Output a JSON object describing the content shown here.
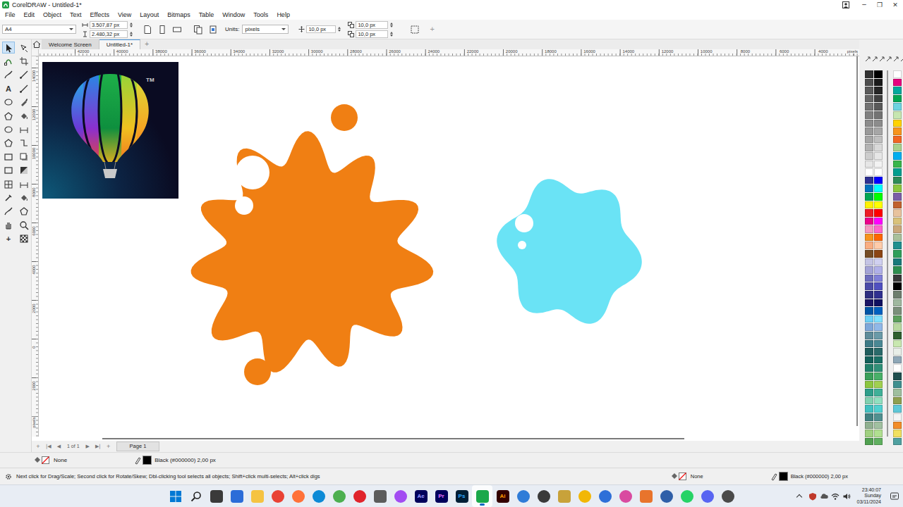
{
  "window": {
    "title": "CorelDRAW - Untitled-1*",
    "controls": [
      "─",
      "❐",
      "✕"
    ]
  },
  "menu": [
    "File",
    "Edit",
    "Object",
    "Text",
    "Effects",
    "View",
    "Layout",
    "Bitmaps",
    "Table",
    "Window",
    "Tools",
    "Help"
  ],
  "property_bar": {
    "page_size": "A4",
    "width": "3.507,87 px",
    "height": "2.480,32 px",
    "units_label": "Units:",
    "units": "pixels",
    "nudge": "10,0 px",
    "dup_x": "10,0 px",
    "dup_y": "10,0 px",
    "add": "+"
  },
  "tools": [
    {
      "selected": true
    },
    {
      "selected": false
    },
    {
      "selected": false
    },
    {
      "selected": false
    },
    {
      "selected": false
    },
    {
      "selected": false
    },
    {
      "selected": false,
      "glyph": "A"
    },
    {
      "selected": false
    },
    {
      "selected": false
    },
    {
      "selected": false
    },
    {
      "selected": false
    },
    {
      "selected": false
    },
    {
      "selected": false
    },
    {
      "selected": false
    },
    {
      "selected": false
    },
    {
      "selected": false
    },
    {
      "selected": false
    },
    {
      "selected": false
    },
    {
      "selected": false
    },
    {
      "selected": false
    },
    {
      "selected": false
    },
    {
      "selected": false
    },
    {
      "selected": false
    },
    {
      "selected": false
    },
    {
      "selected": false
    },
    {
      "selected": false
    },
    {
      "selected": false
    },
    {
      "selected": false
    },
    {
      "selected": false,
      "glyph": "+"
    },
    {
      "selected": false
    }
  ],
  "doc_tabs": [
    {
      "label": "Welcome Screen",
      "selected": false
    },
    {
      "label": "Untitled-1*",
      "selected": true
    }
  ],
  "doc_tab_add": "+",
  "ruler": {
    "h_labels": [
      "42000",
      "40000",
      "38000",
      "36000",
      "34000",
      "32000",
      "30000",
      "28000",
      "26000",
      "24000",
      "22000",
      "20000",
      "18000",
      "16000",
      "14000",
      "12000",
      "10000",
      "8000",
      "6000",
      "4000"
    ],
    "v_labels": [
      "14000",
      "12000",
      "10000",
      "8000",
      "6000",
      "4000",
      "2000",
      "0",
      "2000"
    ],
    "unit": "pixels"
  },
  "canvas": {
    "logo": {
      "tm": "TM"
    },
    "shapes": [
      {
        "kind": "splat",
        "color": "#f07f13"
      },
      {
        "kind": "blob",
        "color": "#6ae3f5"
      }
    ]
  },
  "page_nav": {
    "before": [
      "+",
      "|◀",
      "◀"
    ],
    "counter": "1 of 1",
    "after": [
      "▶",
      "▶|",
      "+"
    ],
    "pages": [
      {
        "label": "Page 1",
        "selected": true
      }
    ]
  },
  "palettes": [
    {
      "columns": [
        [
          "#333333",
          "#4d4d4d",
          "#595959",
          "#666666",
          "#737373",
          "#808080",
          "#8c8c8c",
          "#999999",
          "#a6a6a6",
          "#b3b3b3",
          "#cccccc",
          "#e6e6e6",
          "#ffffff",
          "#2e3192",
          "#0072bc",
          "#00a651",
          "#fff200",
          "#ed1c24",
          "#ec008c",
          "#f49ac1",
          "#f7941d",
          "#f9ad81",
          "#754c24",
          "#c4c4e4",
          "#a3a3d6",
          "#6d6dbd",
          "#4b4ba8",
          "#2e2e80",
          "#1b1464",
          "#0054a6",
          "#6dcff6",
          "#7da7d9",
          "#5e8c9a",
          "#3d7a86",
          "#1f5c5c",
          "#13605a",
          "#20806a",
          "#3aa05a",
          "#8cc63f",
          "#2e9e8a",
          "#80d0b0",
          "#40c0c0",
          "#408080",
          "#90b090",
          "#a0d080",
          "#50a050"
        ],
        [
          "#000000",
          "#1a1a1a",
          "#262626",
          "#404040",
          "#595959",
          "#737373",
          "#8c8c8c",
          "#a6a6a6",
          "#bfbfbf",
          "#d9d9d9",
          "#e6e6e6",
          "#f2f2f2",
          "#ffffff",
          "#0000ff",
          "#00ffff",
          "#00ff00",
          "#ffff00",
          "#ff0000",
          "#ff00ff",
          "#ff66cc",
          "#ff6600",
          "#ffccaa",
          "#8b4513",
          "#d0d0f0",
          "#b0b0e8",
          "#8080d8",
          "#5050c0",
          "#303090",
          "#101060",
          "#0060c0",
          "#80e0ff",
          "#90b8e8",
          "#6a9aa8",
          "#4a8894",
          "#2a6a6a",
          "#1a7066",
          "#309078",
          "#48b068",
          "#a0d050",
          "#40b098",
          "#90e0c0",
          "#50d0d0",
          "#509090",
          "#a0c0a0",
          "#b0e090",
          "#60b060"
        ]
      ]
    },
    {
      "columns": [
        [
          "#ffffff",
          "#e6007e",
          "#00a99d",
          "#00a651",
          "#6dd3e0",
          "#c6e6b0",
          "#ffd200",
          "#f7941d",
          "#f26522",
          "#a8d08d",
          "#00aeef",
          "#39b54a",
          "#009e8e",
          "#2e8b57",
          "#8dc63f",
          "#7b5ea7",
          "#c1622f",
          "#e8c39e",
          "#d9c27a",
          "#c9a77a",
          "#a8c09a",
          "#1f8f8f",
          "#2f9e5a",
          "#1a7a7a",
          "#2f8f4f",
          "#3a3a3a",
          "#000000",
          "#6e7e6e",
          "#9fb89f",
          "#7a8f7a",
          "#5c9e5c",
          "#b8d8a0",
          "#2f5f2f",
          "#c8e8b0",
          "#e8eee8",
          "#8fa8b8",
          "#ffffff",
          "#1f4f4f",
          "#3f8f8f",
          "#9fbf9f",
          "#8f9f4f",
          "#5fc8d8",
          "#f4f4f4",
          "#f28c28",
          "#f0e060",
          "#4fa0a0"
        ]
      ]
    }
  ],
  "fill_outline": {
    "fill": "None",
    "outline": "Black (#000000) 2,00 px",
    "outline_color": "#000000"
  },
  "status_bar": {
    "hint": "Next click for Drag/Scale; Second click for Rotate/Skew; Dbl-clicking tool selects all objects; Shift+click multi-selects; Alt+click digs",
    "fill": "None",
    "outline": "Black (#000000) 2,00 px",
    "outline_color": "#000000"
  },
  "taskbar": {
    "apps": [
      {
        "kind": "win",
        "color": "#0078d4",
        "running": false
      },
      {
        "kind": "search",
        "color": "#222222",
        "running": false
      },
      {
        "kind": "tile",
        "color": "#3a3a3a",
        "running": false
      },
      {
        "kind": "tile",
        "color": "#2b6cd8",
        "running": false
      },
      {
        "kind": "tile",
        "color": "#f5c342",
        "running": false
      },
      {
        "kind": "round",
        "color": "#e94235",
        "running": false
      },
      {
        "kind": "round",
        "color": "#ff7139",
        "running": false
      },
      {
        "kind": "round",
        "color": "#0c8ad6",
        "running": false
      },
      {
        "kind": "round",
        "color": "#4caf50",
        "running": false
      },
      {
        "kind": "round",
        "color": "#e0242c",
        "running": false
      },
      {
        "kind": "tile",
        "color": "#5c5c5c",
        "running": false
      },
      {
        "kind": "round",
        "color": "#a24cf2",
        "running": false
      },
      {
        "kind": "tile",
        "color": "#00005b",
        "label": "Ae",
        "label_color": "#9999ff",
        "running": false
      },
      {
        "kind": "tile",
        "color": "#00005b",
        "label": "Pr",
        "label_color": "#ea77ff",
        "running": false
      },
      {
        "kind": "tile",
        "color": "#001e36",
        "label": "Ps",
        "label_color": "#31a8ff",
        "running": false
      },
      {
        "kind": "tile",
        "color": "#1aa84a",
        "running": true
      },
      {
        "kind": "tile",
        "color": "#330000",
        "label": "Ai",
        "label_color": "#ff9a00",
        "running": false
      },
      {
        "kind": "round",
        "color": "#2f7cd8",
        "running": false
      },
      {
        "kind": "round",
        "color": "#3a3a3a",
        "running": false
      },
      {
        "kind": "tile",
        "color": "#c8a23a",
        "running": false
      },
      {
        "kind": "round",
        "color": "#f2b705",
        "running": false
      },
      {
        "kind": "round",
        "color": "#2e6fd8",
        "running": false
      },
      {
        "kind": "round",
        "color": "#d94aa0",
        "running": false
      },
      {
        "kind": "tile",
        "color": "#e8742c",
        "running": false
      },
      {
        "kind": "round",
        "color": "#2f5fa8",
        "running": false
      },
      {
        "kind": "round",
        "color": "#25d366",
        "running": false
      },
      {
        "kind": "round",
        "color": "#5865f2",
        "running": false
      },
      {
        "kind": "round",
        "color": "#4a4a4a",
        "running": false
      }
    ],
    "time": "23:40:07",
    "day": "Sunday",
    "date": "03/11/2024"
  }
}
